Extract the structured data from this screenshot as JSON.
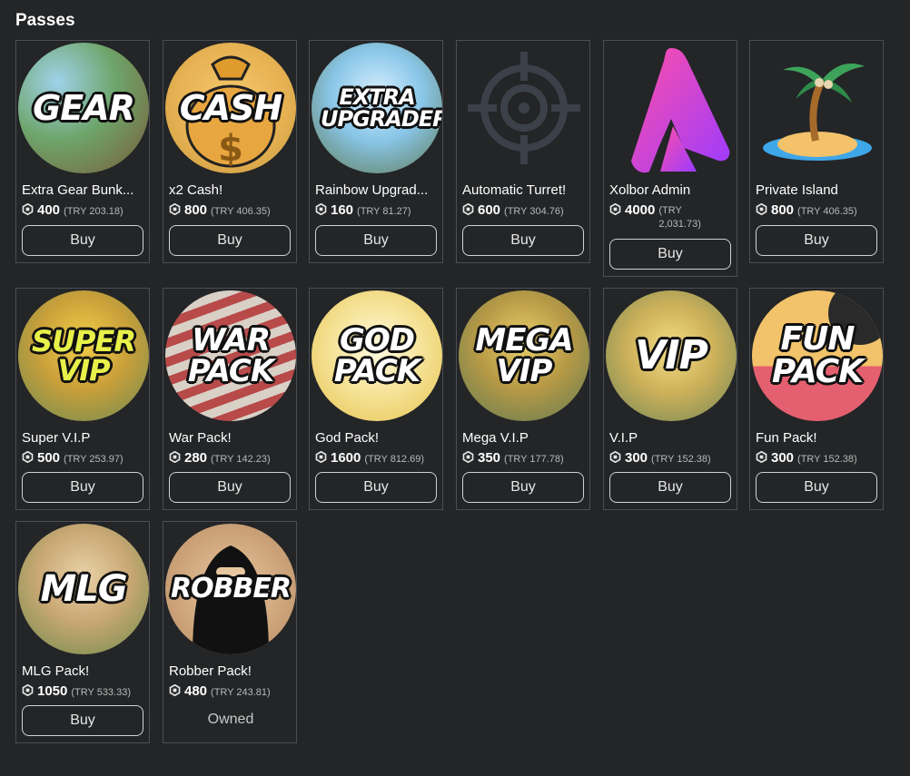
{
  "page": {
    "title": "Passes"
  },
  "colors": {
    "background": "#232527",
    "card_border": "#4b4e53",
    "button_border": "#d0d2d5"
  },
  "passes": [
    {
      "name": "Extra Gear Bunk...",
      "thumb_text": "GEAR",
      "price": "400",
      "try_price": "(TRY 203.18)",
      "action": "Buy",
      "icon": "gear-pass-art"
    },
    {
      "name": "x2 Cash!",
      "thumb_text": "CASH",
      "price": "800",
      "try_price": "(TRY 406.35)",
      "action": "Buy",
      "icon": "cash-bag-art"
    },
    {
      "name": "Rainbow Upgrad...",
      "thumb_text": "EXTRA UPGRADER",
      "price": "160",
      "try_price": "(TRY 81.27)",
      "action": "Buy",
      "icon": "upgrader-art"
    },
    {
      "name": "Automatic Turret!",
      "thumb_text": "",
      "price": "600",
      "try_price": "(TRY 304.76)",
      "action": "Buy",
      "icon": "crosshair-icon"
    },
    {
      "name": "Xolbor Admin",
      "thumb_text": "",
      "price": "4000",
      "try_price": "(TRY 2,031.73)",
      "action": "Buy",
      "icon": "admin-logo-icon"
    },
    {
      "name": "Private Island",
      "thumb_text": "",
      "price": "800",
      "try_price": "(TRY 406.35)",
      "action": "Buy",
      "icon": "palm-island-icon"
    },
    {
      "name": "Super V.I.P",
      "thumb_text": "SUPER VIP",
      "price": "500",
      "try_price": "(TRY 253.97)",
      "action": "Buy",
      "icon": "super-vip-art"
    },
    {
      "name": "War Pack!",
      "thumb_text": "WAR PACK",
      "price": "280",
      "try_price": "(TRY 142.23)",
      "action": "Buy",
      "icon": "war-pack-art"
    },
    {
      "name": "God Pack!",
      "thumb_text": "GOD PACK",
      "price": "1600",
      "try_price": "(TRY 812.69)",
      "action": "Buy",
      "icon": "god-pack-art"
    },
    {
      "name": "Mega V.I.P",
      "thumb_text": "MEGA VIP",
      "price": "350",
      "try_price": "(TRY 177.78)",
      "action": "Buy",
      "icon": "mega-vip-art"
    },
    {
      "name": "V.I.P",
      "thumb_text": "VIP",
      "price": "300",
      "try_price": "(TRY 152.38)",
      "action": "Buy",
      "icon": "vip-art"
    },
    {
      "name": "Fun Pack!",
      "thumb_text": "FUN PACK",
      "price": "300",
      "try_price": "(TRY 152.38)",
      "action": "Buy",
      "icon": "fun-pack-art"
    },
    {
      "name": "MLG Pack!",
      "thumb_text": "MLG",
      "price": "1050",
      "try_price": "(TRY 533.33)",
      "action": "Buy",
      "icon": "mlg-pack-art"
    },
    {
      "name": "Robber Pack!",
      "thumb_text": "ROBBER",
      "price": "480",
      "try_price": "(TRY 243.81)",
      "action": "Owned",
      "icon": "robber-pack-art"
    }
  ]
}
